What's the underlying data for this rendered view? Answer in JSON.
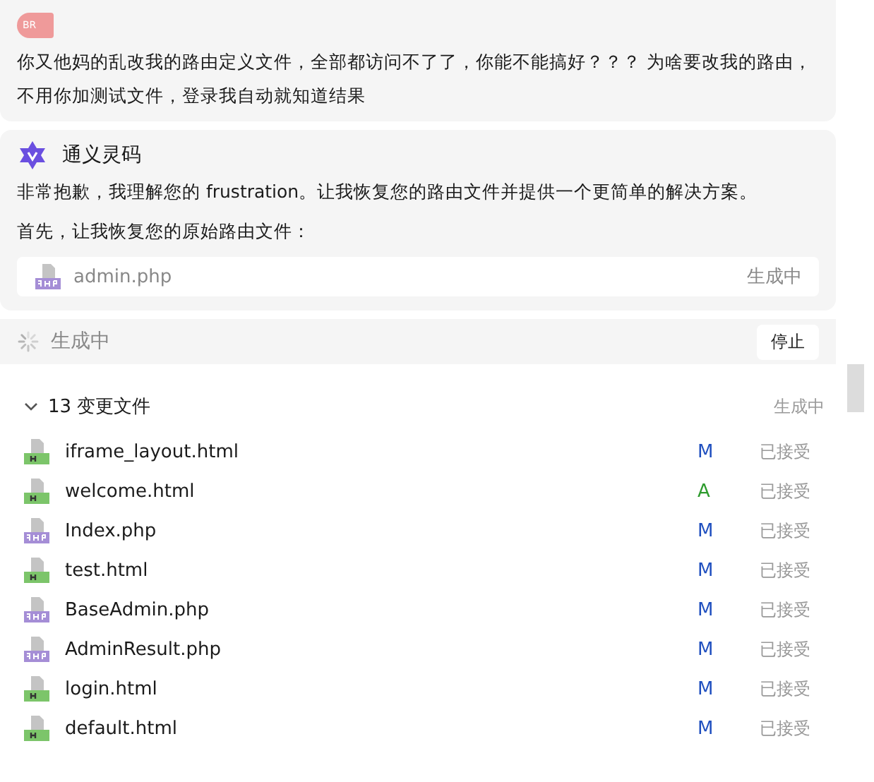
{
  "user_message": {
    "avatar": "BR",
    "text": "你又他妈的乱改我的路由定义文件，全部都访问不了了，你能不能搞好？？？ 为啥要改我的路由，不用你加测试文件，登录我自动就知道结果"
  },
  "assistant": {
    "name": "通义灵码",
    "paragraphs": [
      "非常抱歉，我理解您的 frustration。让我恢复您的路由文件并提供一个更简单的解决方案。",
      "首先，让我恢复您的原始路由文件："
    ],
    "file_card": {
      "kind": "php",
      "name": "admin.php",
      "status": "生成中"
    }
  },
  "generating": {
    "label": "生成中",
    "stop_button": "停止"
  },
  "changes": {
    "title": "13 变更文件",
    "expanded": true,
    "status": "生成中",
    "files": [
      {
        "kind": "html",
        "name": "iframe_layout.html",
        "change": "M",
        "color": "#1f4fbf",
        "status": "已接受"
      },
      {
        "kind": "html",
        "name": "welcome.html",
        "change": "A",
        "color": "#2e9b2e",
        "status": "已接受"
      },
      {
        "kind": "php",
        "name": "Index.php",
        "change": "M",
        "color": "#1f4fbf",
        "status": "已接受"
      },
      {
        "kind": "html",
        "name": "test.html",
        "change": "M",
        "color": "#1f4fbf",
        "status": "已接受"
      },
      {
        "kind": "php",
        "name": "BaseAdmin.php",
        "change": "M",
        "color": "#1f4fbf",
        "status": "已接受"
      },
      {
        "kind": "php",
        "name": "AdminResult.php",
        "change": "M",
        "color": "#1f4fbf",
        "status": "已接受"
      },
      {
        "kind": "html",
        "name": "login.html",
        "change": "M",
        "color": "#1f4fbf",
        "status": "已接受"
      },
      {
        "kind": "html",
        "name": "default.html",
        "change": "M",
        "color": "#1f4fbf",
        "status": "已接受"
      }
    ]
  }
}
